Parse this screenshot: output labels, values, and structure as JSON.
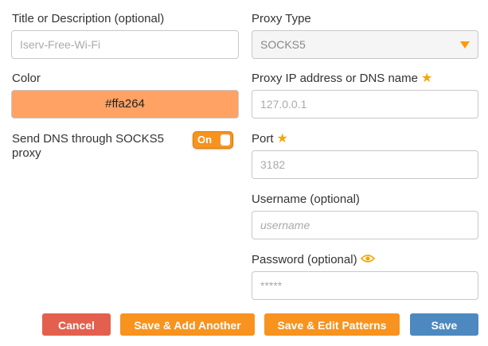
{
  "colors": {
    "accent": "#f7931e",
    "color_swatch": "#ffa264",
    "cancel_button": "#e4604e",
    "orange_button": "#f7931e",
    "save_button": "#4d89c0"
  },
  "form": {
    "title_label": "Title or Description (optional)",
    "title_placeholder": "Iserv-Free-Wi-Fi",
    "color_label": "Color",
    "color_value": "#ffa264",
    "dns_label": "Send DNS through SOCKS5 proxy",
    "dns_toggle": "On",
    "proxy_type_label": "Proxy Type",
    "proxy_type_value": "SOCKS5",
    "proxy_ip_label": "Proxy IP address or DNS name",
    "proxy_ip_placeholder": "127.0.0.1",
    "port_label": "Port",
    "port_placeholder": "3182",
    "username_label": "Username (optional)",
    "username_placeholder": "username",
    "password_label": "Password (optional)",
    "password_placeholder": "*****",
    "required_icon": "star-icon",
    "show_password_icon": "eye-icon"
  },
  "buttons": {
    "cancel": "Cancel",
    "save_add_another": "Save & Add Another",
    "save_edit_patterns": "Save & Edit Patterns",
    "save": "Save"
  }
}
